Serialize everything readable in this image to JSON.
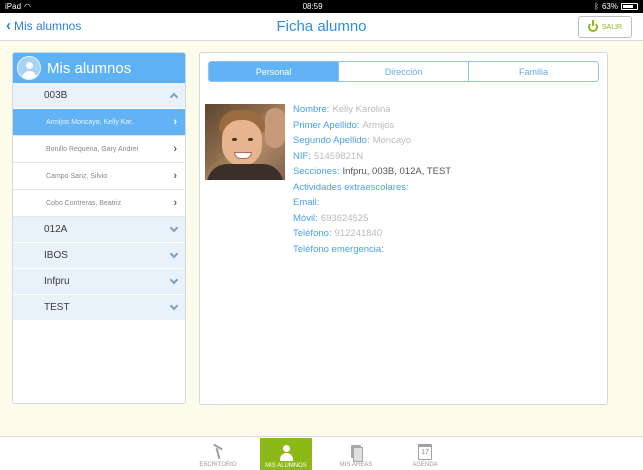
{
  "status_bar": {
    "device": "iPad",
    "time": "08:59",
    "battery": "63%"
  },
  "nav": {
    "back_label": "Mis alumnos",
    "title": "Ficha alumno",
    "logout_label": "SALIR"
  },
  "left": {
    "title": "Mis alumnos",
    "groups": [
      {
        "name": "003B",
        "expanded": true,
        "students": [
          "Armijos Moncayo, Kelly Kar..",
          "Bonillo Requena, Gary Andrei",
          "Campo Sanz, Silvio",
          "Cobo Contreras, Beatriz"
        ]
      },
      {
        "name": "012A"
      },
      {
        "name": "IBOS"
      },
      {
        "name": "Infpru"
      },
      {
        "name": "TEST"
      }
    ]
  },
  "tabs": {
    "personal": "Personal",
    "direccion": "Dirección",
    "familia": "Familia"
  },
  "student": {
    "nombre_label": "Nombre:",
    "nombre": "Kelly Karolina",
    "primer_label": "Primer Apellido:",
    "primer": "Armijos",
    "segundo_label": "Segundo Apellido:",
    "segundo": "Moncayo",
    "nif_label": "NIF:",
    "nif": "51459821N",
    "secciones_label": "Secciones:",
    "secciones": "Infpru, 003B, 012A, TEST",
    "actividades_label": "Actividades extraescolares:",
    "email_label": "Email:",
    "movil_label": "Móvil:",
    "movil": "693624525",
    "telefono_label": "Teléfono:",
    "telefono": "912241840",
    "emergencia_label": "Teléfono emergencia:"
  },
  "tabbar": {
    "escritorio": "ESCRITORIO",
    "mis_alumnos": "MIS ALUMNOS",
    "mis_areas": "MIS ÁREAS",
    "agenda": "AGENDA",
    "agenda_day": "17"
  },
  "colors": {
    "accent_blue": "#62b3f5",
    "accent_green": "#8cb918",
    "background": "#fdfbe9"
  }
}
